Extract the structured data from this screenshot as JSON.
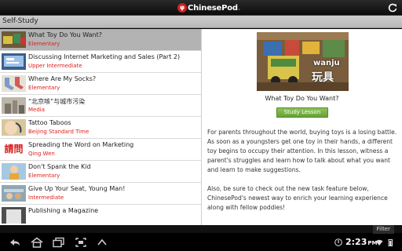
{
  "app": {
    "brand": "ChinesePod",
    "brand_dot": "."
  },
  "section": {
    "title": "Self-Study"
  },
  "lessons": [
    {
      "title": "What Toy Do You Want?",
      "level": "Elementary"
    },
    {
      "title": "Discussing Internet Marketing and Sales (Part 2)",
      "level": "Upper Intermediate"
    },
    {
      "title": "Where Are My Socks?",
      "level": "Elementary"
    },
    {
      "title": "“北京咳”与城市污染",
      "level": "Media"
    },
    {
      "title": "Tattoo Taboos",
      "level": "Beijing Standard Time"
    },
    {
      "title": "Spreading the Word on Marketing",
      "level": "Qing Wen"
    },
    {
      "title": "Don't Spank the Kid",
      "level": "Elementary"
    },
    {
      "title": "Give Up Your Seat, Young Man!",
      "level": "Intermediate"
    },
    {
      "title": "Publishing a Magazine",
      "level": ""
    }
  ],
  "thumb_texts": {
    "qingwen": "請問"
  },
  "detail": {
    "hero_word": "wanju",
    "hero_hanzi": "玩具",
    "title": "What Toy Do You Want?",
    "button": "Study Lesson",
    "paragraph1": "For parents throughout the world, buying toys is a losing battle. As soon as a youngsters get one toy in their hands, a different toy begins to occupy their attention. In this lesson, witness a parent's struggles and learn how to talk about what you want and learn to make suggestions.",
    "paragraph2": "Also, be sure to check out the new task feature below, ChinesePod's newest way to enrich your learning experience along with fellow poddies!"
  },
  "filter": {
    "label": "Filter"
  },
  "system": {
    "time": "2:23",
    "ampm": "PM"
  },
  "colors": {
    "level": "#e0201c",
    "button": "#66a234",
    "selected_row": "#b3b3b3"
  }
}
